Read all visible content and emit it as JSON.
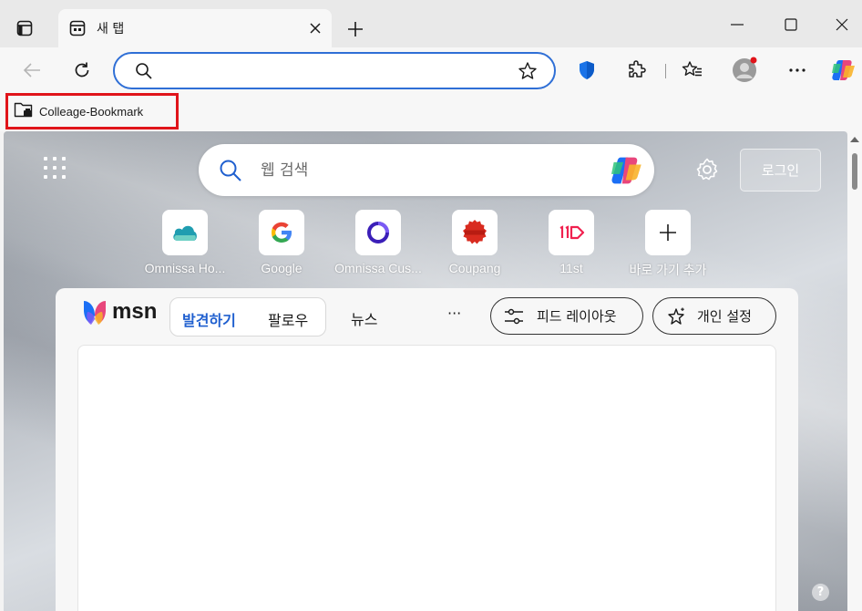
{
  "browser": {
    "tab": {
      "title": "새 탭"
    },
    "omnibox": {
      "value": "",
      "placeholder": ""
    },
    "bookmarks": [
      {
        "label": "Colleage-Bookmark"
      }
    ]
  },
  "newtab": {
    "search": {
      "placeholder": "웹 검색"
    },
    "login_label": "로그인",
    "shortcuts": [
      {
        "label": "Omnissa Ho..."
      },
      {
        "label": "Google"
      },
      {
        "label": "Omnissa Cus..."
      },
      {
        "label": "Coupang"
      },
      {
        "label": "11st"
      },
      {
        "label": "바로 가기 추가"
      }
    ],
    "msn": {
      "logo_text": "msn",
      "tabs": [
        {
          "label": "발견하기"
        },
        {
          "label": "팔로우"
        }
      ],
      "news_label": "뉴스",
      "more_label": "···",
      "feed_layout_label": "피드 레이아웃",
      "personalize_label": "개인 설정"
    },
    "help_label": "?"
  },
  "colors": {
    "accent": "#2f6fd6",
    "bookmark_highlight": "#e0141a",
    "msn_active": "#1f5fcf"
  }
}
